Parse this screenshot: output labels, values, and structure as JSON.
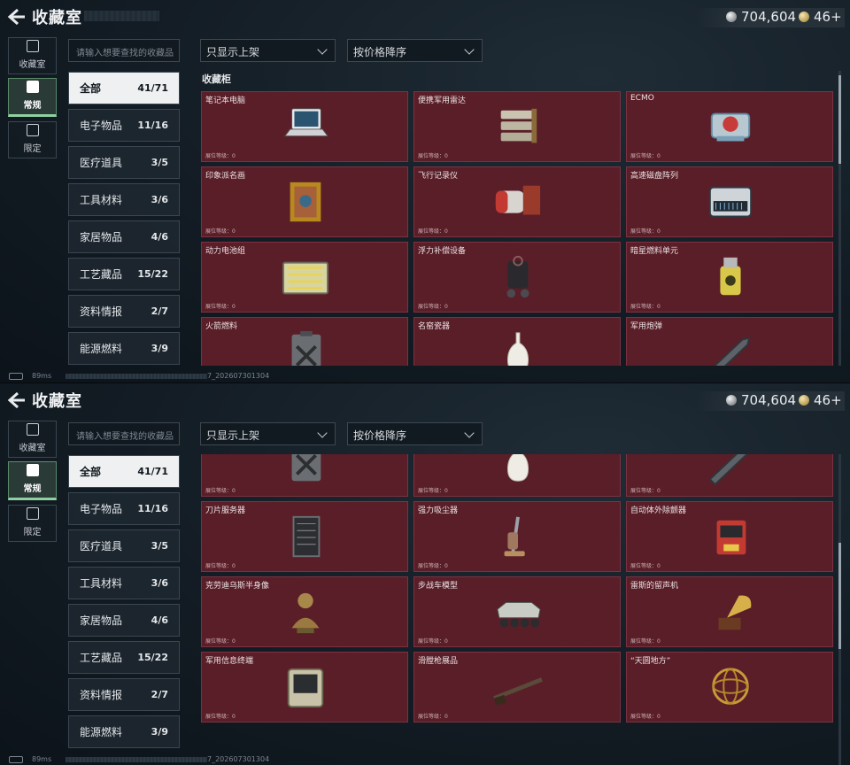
{
  "header": {
    "title": "收藏室"
  },
  "currency": {
    "coins": "704,604",
    "tickets": "46+"
  },
  "side_tabs": [
    {
      "label": "收藏室",
      "icon": "vault-icon"
    },
    {
      "label": "常规",
      "icon": "image-icon"
    },
    {
      "label": "限定",
      "icon": "image-limited-icon"
    }
  ],
  "search": {
    "placeholder": "请输入想要查找的收藏品"
  },
  "filters": {
    "availability": "只显示上架",
    "sort": "按价格降序"
  },
  "categories": [
    {
      "label": "全部",
      "count": "41/71"
    },
    {
      "label": "电子物品",
      "count": "11/16"
    },
    {
      "label": "医疗道具",
      "count": "3/5"
    },
    {
      "label": "工具材料",
      "count": "3/6"
    },
    {
      "label": "家居物品",
      "count": "4/6"
    },
    {
      "label": "工艺藏品",
      "count": "15/22"
    },
    {
      "label": "资料情报",
      "count": "2/7"
    },
    {
      "label": "能源燃料",
      "count": "3/9"
    }
  ],
  "section_title": "收藏柜",
  "level_label": "展位等级：0",
  "items": [
    {
      "name": "笔记本电脑",
      "icon": "laptop-icon"
    },
    {
      "name": "便携军用雷达",
      "icon": "radar-icon"
    },
    {
      "name": "ECMO",
      "icon": "ecmo-icon"
    },
    {
      "name": "印象派名画",
      "icon": "painting-icon"
    },
    {
      "name": "飞行记录仪",
      "icon": "flight-recorder-icon"
    },
    {
      "name": "高速磁盘阵列",
      "icon": "disk-array-icon"
    },
    {
      "name": "动力电池组",
      "icon": "battery-pack-icon"
    },
    {
      "name": "浮力补偿设备",
      "icon": "buoyancy-device-icon"
    },
    {
      "name": "暗星燃料单元",
      "icon": "fuel-cell-icon"
    },
    {
      "name": "火箭燃料",
      "icon": "fuel-can-icon"
    },
    {
      "name": "名窑瓷器",
      "icon": "vase-icon"
    },
    {
      "name": "军用炮弹",
      "icon": "shell-icon"
    },
    {
      "name": "刀片服务器",
      "icon": "server-icon"
    },
    {
      "name": "强力吸尘器",
      "icon": "vacuum-icon"
    },
    {
      "name": "自动体外除颤器",
      "icon": "defibrillator-icon"
    },
    {
      "name": "克劳迪乌斯半身像",
      "icon": "bust-icon"
    },
    {
      "name": "步战车模型",
      "icon": "ifv-model-icon"
    },
    {
      "name": "雷斯的留声机",
      "icon": "gramophone-icon"
    },
    {
      "name": "军用信息终端",
      "icon": "terminal-icon"
    },
    {
      "name": "滑膛枪展品",
      "icon": "musket-icon"
    },
    {
      "name": "“天圆地方”",
      "icon": "armillary-icon"
    }
  ],
  "status": {
    "ping": "89ms",
    "version": "7_202607301304"
  }
}
